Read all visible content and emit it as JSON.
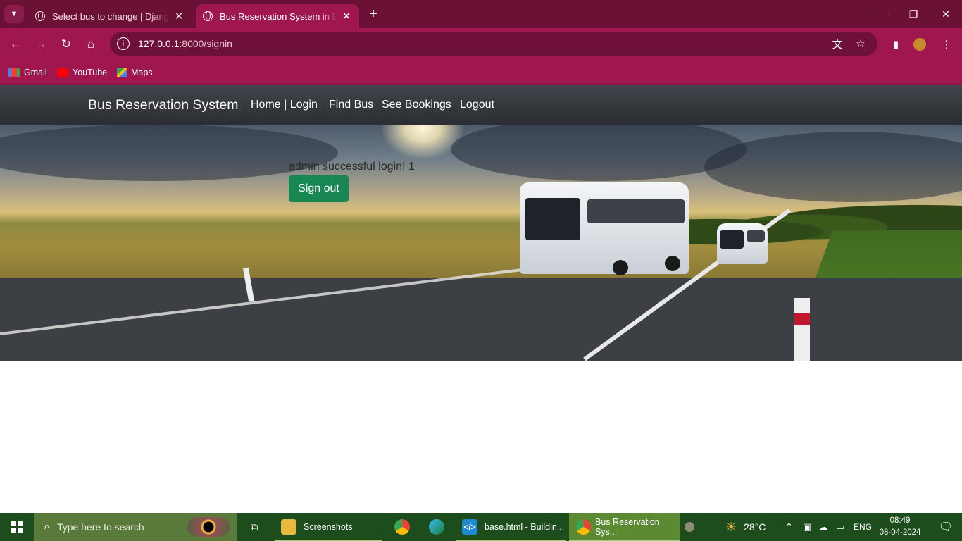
{
  "browser": {
    "tabs": [
      {
        "title": "Select bus to change | Django s",
        "active": false
      },
      {
        "title": "Bus Reservation System in Djang",
        "active": true
      }
    ],
    "url_host": "127.0.0.1",
    "url_path": ":8000/signin",
    "bookmarks": [
      {
        "label": "Gmail",
        "icon": "gmail-icon"
      },
      {
        "label": "YouTube",
        "icon": "youtube-icon"
      },
      {
        "label": "Maps",
        "icon": "maps-icon"
      }
    ],
    "colors": {
      "frame": "#6b1136",
      "toolbar": "#a0164f"
    }
  },
  "site": {
    "brand": "Bus Reservation System",
    "nav": {
      "home_login": "Home | Login",
      "find_bus": "Find Bus",
      "see_bookings": "See Bookings",
      "logout": "Logout"
    },
    "flash_message": "admin successful login! 1",
    "signout_label": "Sign out",
    "colors": {
      "navbar": "#343a40",
      "signout": "#198754"
    }
  },
  "taskbar": {
    "search_placeholder": "Type here to search",
    "apps": [
      {
        "label": "Screenshots",
        "icon": "folder-icon"
      },
      {
        "label": "",
        "icon": "chrome-icon"
      },
      {
        "label": "",
        "icon": "edge-icon"
      },
      {
        "label": "base.html - Buildin...",
        "icon": "vscode-icon"
      },
      {
        "label": "Bus Reservation Sys...",
        "icon": "chrome-icon"
      }
    ],
    "weather": "28°C",
    "language": "ENG",
    "time": "08:49",
    "date": "08-04-2024"
  }
}
